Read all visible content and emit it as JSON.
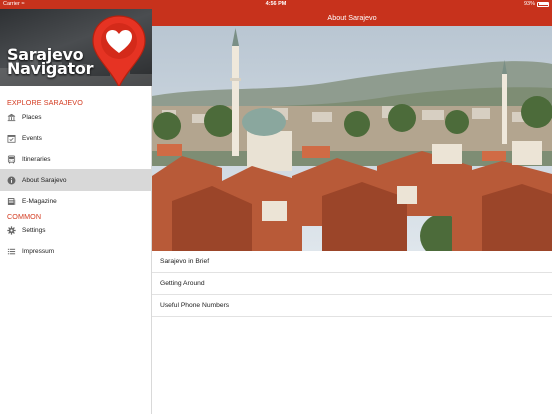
{
  "status_bar": {
    "carrier": "Carrier",
    "time": "4:56 PM",
    "battery": "93%",
    "battery_level": 0.93
  },
  "logo": {
    "line1": "Sarajevo",
    "line2": "Navigator",
    "pin_color": "#e63323"
  },
  "sidebar": {
    "explore_header": "EXPLORE SARAJEVO",
    "items": [
      {
        "label": "Places",
        "icon": "bank-icon"
      },
      {
        "label": "Events",
        "icon": "calendar-check-icon"
      },
      {
        "label": "Itineraries",
        "icon": "bus-icon"
      },
      {
        "label": "About Sarajevo",
        "icon": "info-icon",
        "active": true
      },
      {
        "label": "E-Magazine",
        "icon": "newspaper-icon"
      }
    ],
    "common_header": "COMMON",
    "common_items": [
      {
        "label": "Settings",
        "icon": "gear-icon"
      },
      {
        "label": "Impressum",
        "icon": "list-icon"
      }
    ]
  },
  "navbar": {
    "title": "About Sarajevo"
  },
  "content": {
    "rows": [
      "Sarajevo in Brief",
      "Getting Around",
      "Useful Phone Numbers"
    ]
  },
  "colors": {
    "brand": "#c7321c",
    "section_header": "#d33a1f",
    "active_row": "#d8d8d8"
  }
}
